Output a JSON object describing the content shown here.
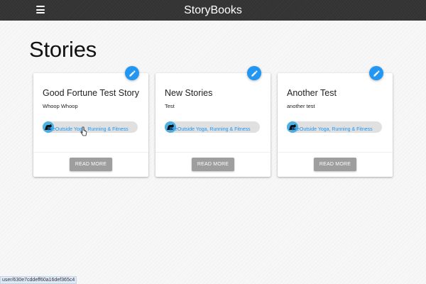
{
  "navbar": {
    "brand": "StoryBooks",
    "menu_icon": "hamburger-menu-icon"
  },
  "page": {
    "title": "Stories"
  },
  "stories": [
    {
      "title": "Good Fortune Test Story",
      "description": "Whoop Whoop",
      "author": "BreOutside Yoga, Running & Fitness",
      "button": "READ MORE"
    },
    {
      "title": "New Stories",
      "description": "Test",
      "author": "BreOutside Yoga, Running & Fitness",
      "button": "READ MORE"
    },
    {
      "title": "Another Test",
      "description": "another test",
      "author": "BreOutside Yoga, Running & Fitness",
      "button": "READ MORE"
    }
  ],
  "icons": {
    "edit": "edit-icon",
    "avatar": "author-avatar-icon",
    "cursor": "mouse-cursor-icon"
  },
  "colors": {
    "navbar": "#333333",
    "accent": "#2196f3",
    "button": "#9e9e9e",
    "chip": "#e0e0e0"
  },
  "status_bar": {
    "url": "user/630e7cddeff60a16def365c4"
  }
}
